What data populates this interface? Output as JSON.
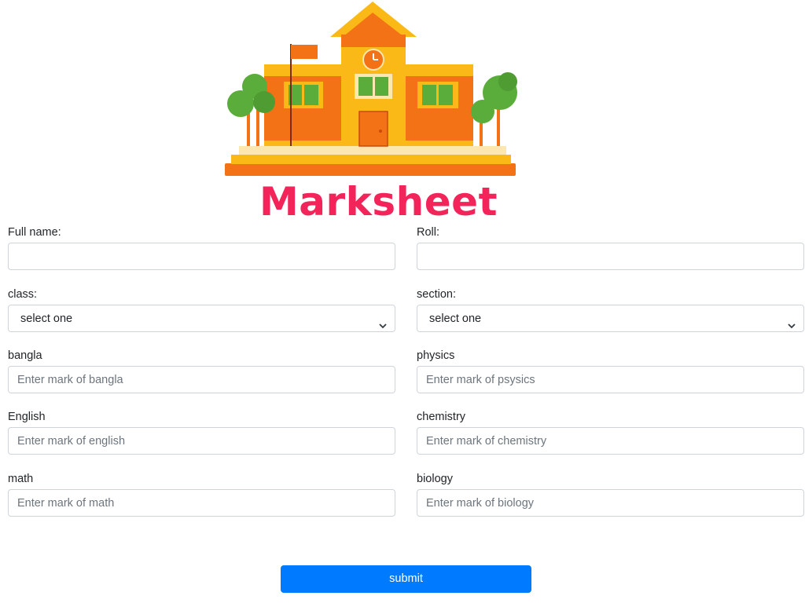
{
  "header": {
    "title": "Marksheet",
    "illustration": "school-building-illustration"
  },
  "form": {
    "full_name": {
      "label": "Full name:",
      "value": "",
      "placeholder": ""
    },
    "roll": {
      "label": "Roll:",
      "value": "",
      "placeholder": ""
    },
    "class": {
      "label": "class:",
      "selected": "select one"
    },
    "section": {
      "label": "section:",
      "selected": "select one"
    },
    "bangla": {
      "label": "bangla",
      "placeholder": "Enter mark of bangla"
    },
    "physics": {
      "label": "physics",
      "placeholder": "Enter mark of psysics"
    },
    "english": {
      "label": "English",
      "placeholder": "Enter mark of english"
    },
    "chemistry": {
      "label": "chemistry",
      "placeholder": "Enter mark of chemistry"
    },
    "math": {
      "label": "math",
      "placeholder": "Enter mark of math"
    },
    "biology": {
      "label": "biology",
      "placeholder": "Enter mark of biology"
    },
    "submit_label": "submit"
  },
  "colors": {
    "title": "#f2245a",
    "submit_button": "#007bff",
    "building_orange": "#f47216",
    "building_yellow": "#fbb917",
    "tree_green": "#5aad3a"
  }
}
